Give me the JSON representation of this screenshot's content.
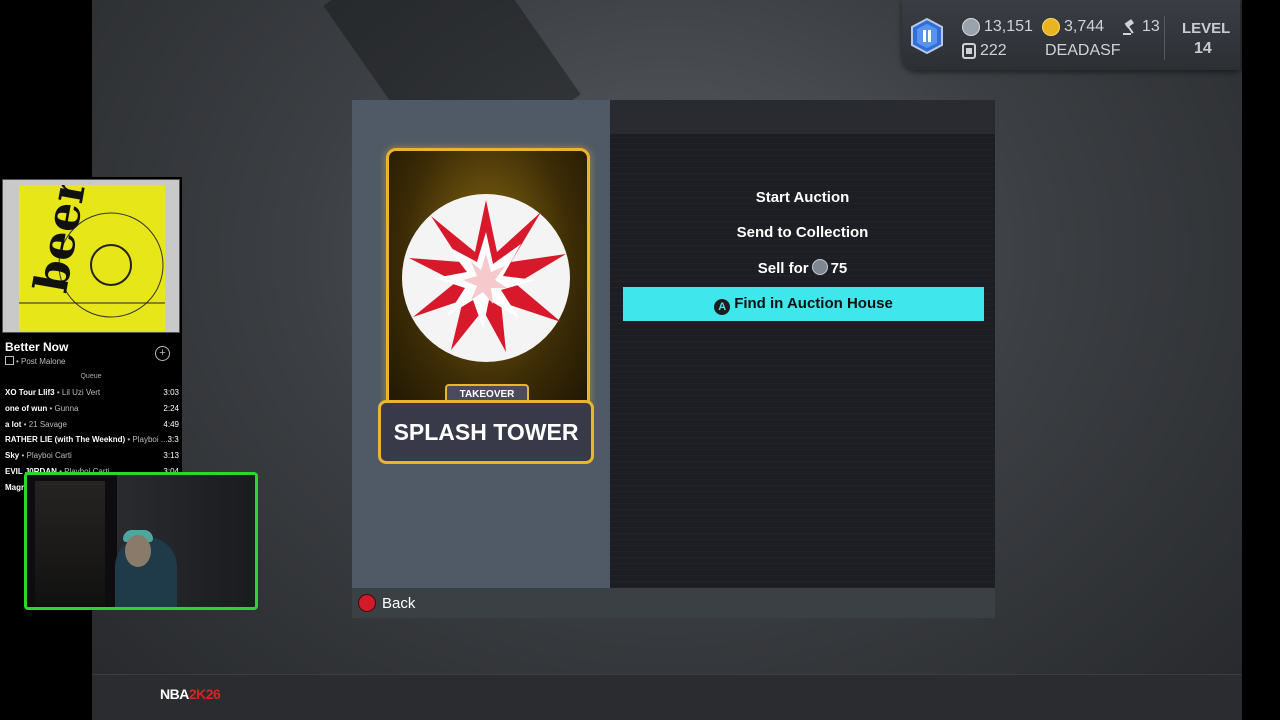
{
  "hud": {
    "mt_amount": "13,151",
    "tokens": "222",
    "vc_amount": "3,744",
    "gavel_count": "13",
    "username": "DEADASF",
    "level_label": "LEVEL",
    "level_value": "14",
    "badge_icon": "pause-badge-icon"
  },
  "card": {
    "tag": "TAKEOVER",
    "name": "SPLASH TOWER",
    "icon": "splash-burst-icon",
    "frame_color": "#e9b52a"
  },
  "menu": {
    "start_auction": "Start Auction",
    "send_to_collection": "Send to Collection",
    "sell_prefix": "Sell for",
    "sell_price": "75",
    "find_in_auction_house": "Find in Auction House",
    "find_button_glyph": "A",
    "active_color": "#3fe6ec"
  },
  "footer": {
    "back_label": "Back"
  },
  "music": {
    "track_title": "Better Now",
    "track_artist": "• Post Malone",
    "queue_label": "Queue",
    "queue": [
      {
        "name": "XO Tour Llif3",
        "artist": " • Lil Uzi Vert",
        "duration": "3:03"
      },
      {
        "name": "one of wun",
        "artist": " • Gunna",
        "duration": "2:24"
      },
      {
        "name": "a lot",
        "artist": " • 21 Savage",
        "duration": "4:49"
      },
      {
        "name": "RATHER LIE (with The Weeknd)",
        "artist": " • Playboi ...",
        "duration": "3:30"
      },
      {
        "name": "Sky",
        "artist": " • Playboi Carti",
        "duration": "3:13"
      },
      {
        "name": "EVIL J0RDAN",
        "artist": " • Playboi Carti",
        "duration": "3:04"
      },
      {
        "name": "Magr",
        "artist": "",
        "duration": ""
      }
    ]
  },
  "branding": {
    "logo_prefix": "NBA",
    "logo_suffix": "2K26"
  }
}
